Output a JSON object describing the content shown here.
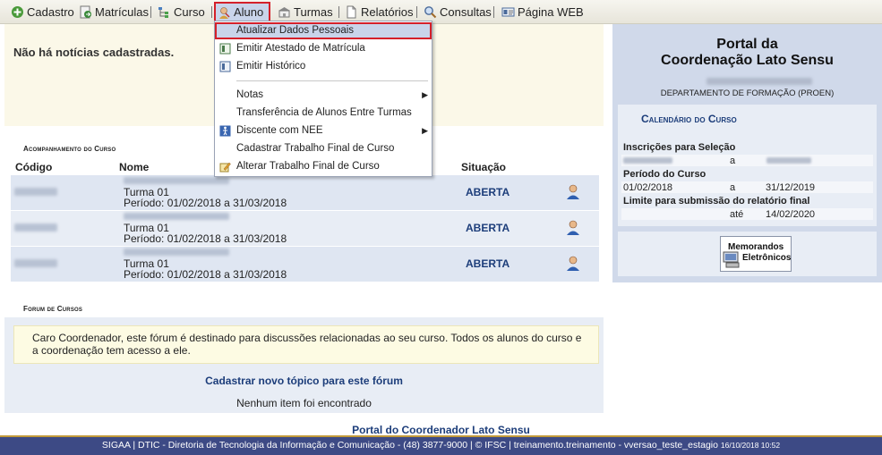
{
  "menubar": {
    "items": [
      {
        "id": "cadastro",
        "label": "Cadastro",
        "icon": "plus-circle-icon"
      },
      {
        "id": "matriculas",
        "label": "Matrículas",
        "icon": "document-arrow-icon"
      },
      {
        "id": "curso",
        "label": "Curso",
        "icon": "tree-icon"
      },
      {
        "id": "aluno",
        "label": "Aluno",
        "icon": "student-icon"
      },
      {
        "id": "turmas",
        "label": "Turmas",
        "icon": "classroom-icon"
      },
      {
        "id": "relatorios",
        "label": "Relatórios",
        "icon": "report-page-icon"
      },
      {
        "id": "consultas",
        "label": "Consultas",
        "icon": "magnifier-icon"
      },
      {
        "id": "pagina_web",
        "label": "Página WEB",
        "icon": "web-card-icon"
      }
    ]
  },
  "aluno_menu": {
    "items": [
      {
        "label": "Atualizar Dados Pessoais"
      },
      {
        "label": "Emitir Atestado de Matrícula"
      },
      {
        "label": "Emitir Histórico"
      },
      {
        "label": "Notas"
      },
      {
        "label": "Transferência de Alunos Entre Turmas"
      },
      {
        "label": "Discente com NEE"
      },
      {
        "label": "Cadastrar Trabalho Final de Curso"
      },
      {
        "label": "Alterar Trabalho Final de Curso"
      }
    ]
  },
  "news": {
    "text": "Não há notícias cadastradas."
  },
  "acompanhamento": {
    "title": "Acompanhamento do Curso",
    "columns": {
      "codigo": "Código",
      "nome": "Nome",
      "situacao": "Situação"
    },
    "rows": [
      {
        "turma": "Turma 01",
        "periodo": "Período: 01/02/2018 a 31/03/2018",
        "situacao": "ABERTA"
      },
      {
        "turma": "Turma 01",
        "periodo": "Período: 01/02/2018 a 31/03/2018",
        "situacao": "ABERTA"
      },
      {
        "turma": "Turma 01",
        "periodo": "Período: 01/02/2018 a 31/03/2018",
        "situacao": "ABERTA"
      }
    ]
  },
  "forum": {
    "title": "Forum de Cursos",
    "message": "Caro Coordenador, este fórum é destinado para discussões relacionadas ao seu curso. Todos os alunos do curso e a coordenação tem acesso a ele.",
    "new_topic": "Cadastrar novo tópico para este fórum",
    "empty": "Nenhum item foi encontrado"
  },
  "portal": {
    "title_line1": "Portal da",
    "title_line2": "Coordenação Lato Sensu",
    "department": "DEPARTAMENTO DE FORMAÇÃO (PROEN)",
    "calendar_title": "Calendário do Curso",
    "inscricoes_label": "Inscrições para Seleção",
    "inscricoes_sep": "a",
    "periodo_label": "Período do Curso",
    "periodo_start": "01/02/2018",
    "periodo_sep": "a",
    "periodo_end": "31/12/2019",
    "limite_label": "Limite para submissão do relatório final",
    "limite_sep": "até",
    "limite_date": "14/02/2020",
    "memo_line1": "Memorandos",
    "memo_line2": "Eletrônicos"
  },
  "footer": {
    "portal_link": "Portal do Coordenador Lato Sensu",
    "text": "SIGAA | DTIC - Diretoria de Tecnologia da Informação e Comunicação - (48) 3877-9000 | © IFSC | treinamento.treinamento - vversao_teste_estagio",
    "timestamp": "16/10/2018 10:52"
  },
  "colors": {
    "link_blue": "#1c3d7a",
    "highlight_red": "#d4202a",
    "panel_blue": "#d0d9ea",
    "footer_bar": "#3d4a85"
  }
}
